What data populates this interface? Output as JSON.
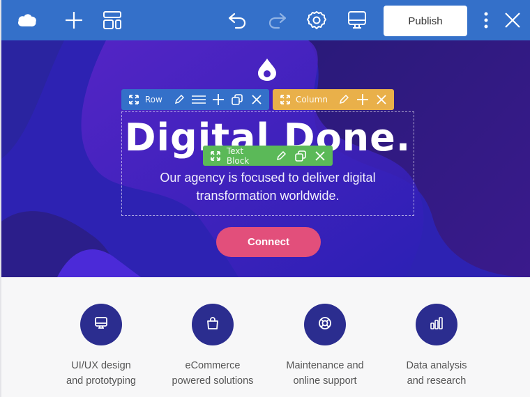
{
  "toolbar": {
    "logo_icon": "cloud-icon",
    "add_icon": "plus-icon",
    "layout_icon": "layout-icon",
    "undo_icon": "undo-icon",
    "redo_icon": "redo-icon",
    "settings_icon": "gear-icon",
    "preview_icon": "monitor-icon",
    "publish_label": "Publish",
    "more_icon": "kebab-menu-icon",
    "close_icon": "close-icon"
  },
  "hero": {
    "logo_icon": "droplet-icon",
    "headline": "Digital Done.",
    "subline": "Our agency is focused to deliver digital transformation worldwide.",
    "cta_label": "Connect"
  },
  "editor": {
    "row_bar": {
      "label": "Row",
      "actions": [
        "move",
        "edit",
        "settings",
        "add",
        "duplicate",
        "delete"
      ]
    },
    "column_bar": {
      "label": "Column",
      "actions": [
        "move",
        "edit",
        "add",
        "delete"
      ]
    },
    "text_block_bar": {
      "label": "Text Block",
      "actions": [
        "move",
        "edit",
        "duplicate",
        "delete"
      ]
    }
  },
  "services": [
    {
      "icon": "monitor-icon",
      "line1": "UI/UX design",
      "line2": "and prototyping"
    },
    {
      "icon": "shopping-bag-icon",
      "line1": "eCommerce",
      "line2": "powered solutions"
    },
    {
      "icon": "lifebuoy-icon",
      "line1": "Maintenance and",
      "line2": "online support"
    },
    {
      "icon": "bar-chart-icon",
      "line1": "Data analysis",
      "line2": "and research"
    }
  ],
  "colors": {
    "toolbar": "#3470c9",
    "row_bar": "#3470c9",
    "column_bar": "#e9b04a",
    "text_block_bar": "#5bb958",
    "cta": "#e24f7b",
    "service_circle": "#2b2d8f"
  }
}
